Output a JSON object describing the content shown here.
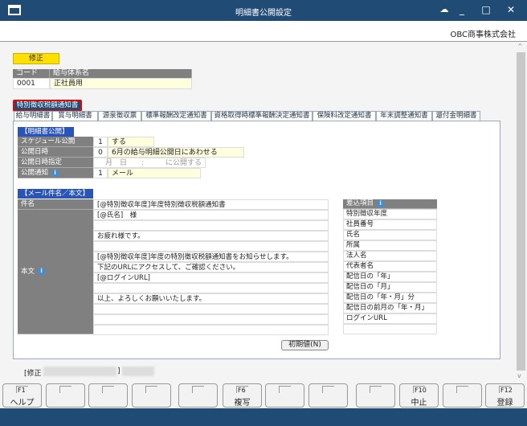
{
  "window": {
    "title": "明細書公開設定",
    "company": "OBC商事株式会社"
  },
  "mode_badge": "修正",
  "code_table": {
    "headers": [
      "コード",
      "給与体系名"
    ],
    "code": "0001",
    "name": "正社員用"
  },
  "active_section": "特別徴収税額通知書",
  "tabs": [
    "給与明細書",
    "賞与明細書",
    "源泉徴収票",
    "標準報酬改定通知書",
    "資格取得時標準報酬決定通知書",
    "保険料改定通知書",
    "年末調整通知書",
    "還付金明細書"
  ],
  "publish": {
    "section": "【明細書公開】",
    "rows": [
      {
        "label": "スケジュール公開",
        "num": "1",
        "value": "する"
      },
      {
        "label": "公開日時",
        "num": "0",
        "value": "6月の給与明細公開日にあわせる"
      },
      {
        "label": "公開日時指定",
        "num": "",
        "value": "月　日　　:　　　に公開する"
      },
      {
        "label": "公開通知",
        "num": "1",
        "value": "メール"
      }
    ]
  },
  "mail": {
    "section": "【メール件名／本文】",
    "subject_label": "件名",
    "subject": "[@特別徴収年度]年度特別徴収税額通知書",
    "body_label": "本文",
    "body_lines": [
      "[@氏名]　様",
      "",
      "お疲れ様です。",
      "",
      "[@特別徴収年度]年度の特別徴収税額通知書をお知らせします。",
      "下記のURLにアクセスして、ご確認ください。",
      "[@ログインURL]",
      "",
      "以上、よろしくお願いいたします。",
      "",
      "",
      ""
    ],
    "reset_button": "初期値(N)"
  },
  "insert_items": {
    "header": "差込項目",
    "items": [
      "特別徴収年度",
      "社員番号",
      "氏名",
      "所属",
      "法人名",
      "代表者名",
      "配信日の「年」",
      "配信日の「月」",
      "配信日の「年・月」分",
      "配信日の前月の「年・月」",
      "ログインURL",
      ""
    ]
  },
  "status": {
    "left": "[修正",
    "right": "]"
  },
  "fkeys": [
    {
      "key": "F1",
      "label": "ヘルプ"
    },
    {
      "key": "",
      "label": ""
    },
    {
      "key": "",
      "label": ""
    },
    {
      "key": "",
      "label": ""
    },
    {
      "key": "",
      "label": ""
    },
    {
      "key": "F6",
      "label": "複写"
    },
    {
      "key": "",
      "label": ""
    },
    {
      "key": "",
      "label": ""
    },
    {
      "key": "",
      "label": ""
    },
    {
      "key": "F10",
      "label": "中止"
    },
    {
      "key": "",
      "label": ""
    },
    {
      "key": "F12",
      "label": "登録"
    }
  ],
  "colors": {
    "titlebar": "#1f4b75",
    "section": "#2a55b8",
    "badge": "#ffe000",
    "highlight": "#ee0000"
  }
}
